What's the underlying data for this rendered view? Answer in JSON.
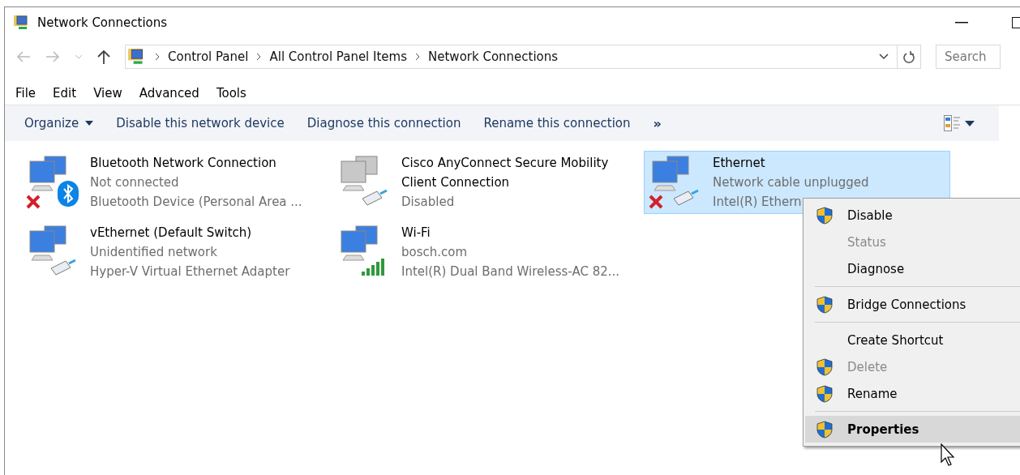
{
  "window": {
    "title": "Network Connections"
  },
  "address": {
    "crumbs": [
      "Control Panel",
      "All Control Panel Items",
      "Network Connections"
    ]
  },
  "search": {
    "placeholder": "Search"
  },
  "menus": [
    "File",
    "Edit",
    "View",
    "Advanced",
    "Tools"
  ],
  "commands": [
    {
      "label": "Organize",
      "kind": "dropdown"
    },
    {
      "label": "Disable this network device",
      "kind": "plain"
    },
    {
      "label": "Diagnose this connection",
      "kind": "plain"
    },
    {
      "label": "Rename this connection",
      "kind": "plain"
    },
    {
      "label": "»",
      "kind": "more"
    }
  ],
  "connections": [
    {
      "name": "Bluetooth Network Connection",
      "status": "Not connected",
      "device": "Bluetooth Device (Personal Area ...",
      "kind": "bluetooth",
      "disconnected": true,
      "disabled": false,
      "selected": false
    },
    {
      "name": "Cisco AnyConnect Secure Mobility Client Connection",
      "status": "Disabled",
      "kind": "cable",
      "disconnected": false,
      "disabled": true,
      "selected": false
    },
    {
      "name": "Ethernet",
      "status": "Network cable unplugged",
      "device": "Intel(R) Ethern",
      "kind": "cable",
      "disconnected": true,
      "disabled": false,
      "selected": true
    },
    {
      "name": "vEthernet (Default Switch)",
      "status": "Unidentified network",
      "device": "Hyper-V Virtual Ethernet Adapter",
      "kind": "cable",
      "disconnected": false,
      "disabled": false,
      "selected": false
    },
    {
      "name": "Wi-Fi",
      "status": "bosch.com",
      "device": "Intel(R) Dual Band Wireless-AC 82...",
      "kind": "wifi",
      "disconnected": false,
      "disabled": false,
      "selected": false
    }
  ],
  "context_menu": [
    {
      "kind": "item",
      "label": "Disable",
      "shield": true,
      "disabled": false,
      "default": false,
      "selected": false
    },
    {
      "kind": "item",
      "label": "Status",
      "shield": false,
      "disabled": true,
      "default": false,
      "selected": false
    },
    {
      "kind": "item",
      "label": "Diagnose",
      "shield": false,
      "disabled": false,
      "default": false,
      "selected": false
    },
    {
      "kind": "separator"
    },
    {
      "kind": "item",
      "label": "Bridge Connections",
      "shield": true,
      "disabled": false,
      "default": false,
      "selected": false
    },
    {
      "kind": "separator"
    },
    {
      "kind": "item",
      "label": "Create Shortcut",
      "shield": false,
      "disabled": false,
      "default": false,
      "selected": false
    },
    {
      "kind": "item",
      "label": "Delete",
      "shield": true,
      "disabled": true,
      "default": false,
      "selected": false
    },
    {
      "kind": "item",
      "label": "Rename",
      "shield": true,
      "disabled": false,
      "default": false,
      "selected": false
    },
    {
      "kind": "separator"
    },
    {
      "kind": "item",
      "label": "Properties",
      "shield": true,
      "disabled": false,
      "default": true,
      "selected": true
    }
  ]
}
